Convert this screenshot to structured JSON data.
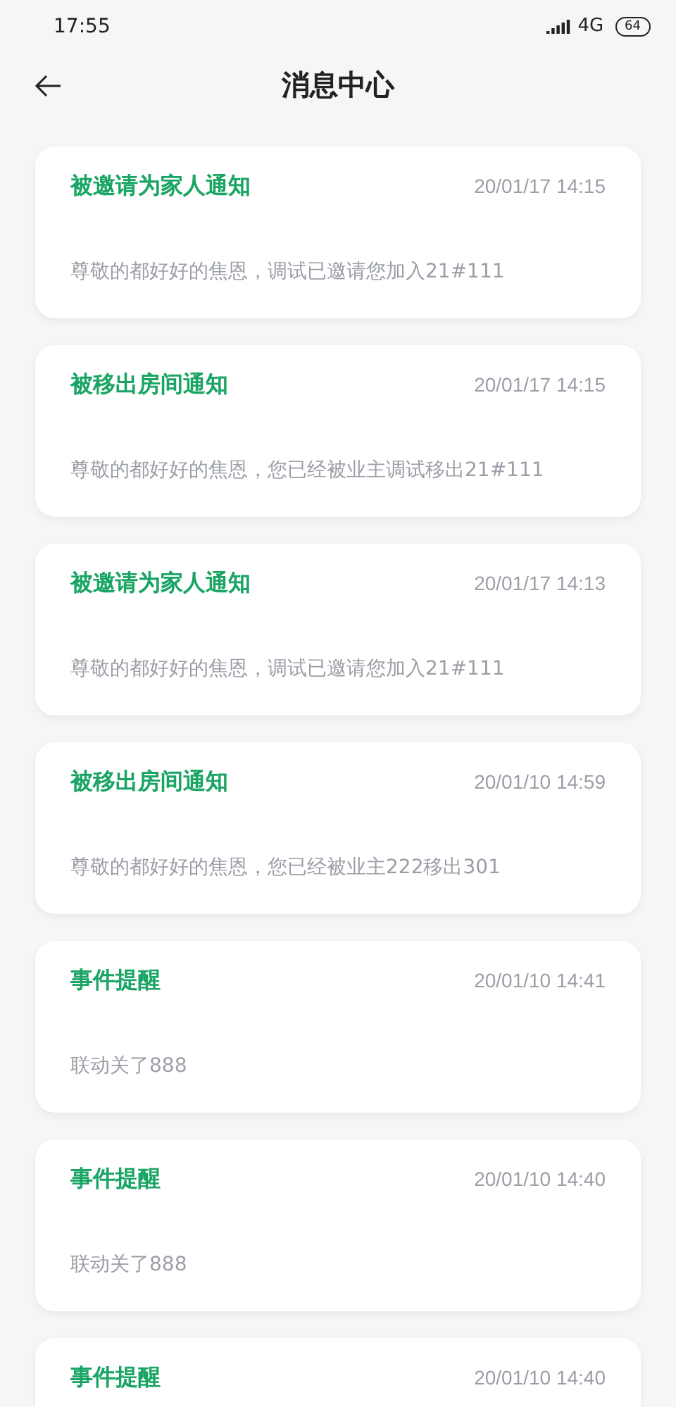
{
  "status_bar": {
    "time": "17:55",
    "network": "4G",
    "battery": "64"
  },
  "header": {
    "title": "消息中心"
  },
  "messages": [
    {
      "title": "被邀请为家人通知",
      "time": "20/01/17 14:15",
      "body": "尊敬的都好好的焦恩，调试已邀请您加入21#111"
    },
    {
      "title": "被移出房间通知",
      "time": "20/01/17 14:15",
      "body": "尊敬的都好好的焦恩，您已经被业主调试移出21#111"
    },
    {
      "title": "被邀请为家人通知",
      "time": "20/01/17 14:13",
      "body": "尊敬的都好好的焦恩，调试已邀请您加入21#111"
    },
    {
      "title": "被移出房间通知",
      "time": "20/01/10 14:59",
      "body": "尊敬的都好好的焦恩，您已经被业主222移出301"
    },
    {
      "title": "事件提醒",
      "time": "20/01/10 14:41",
      "body": "联动关了888"
    },
    {
      "title": "事件提醒",
      "time": "20/01/10 14:40",
      "body": "联动关了888"
    },
    {
      "title": "事件提醒",
      "time": "20/01/10 14:40"
    }
  ]
}
